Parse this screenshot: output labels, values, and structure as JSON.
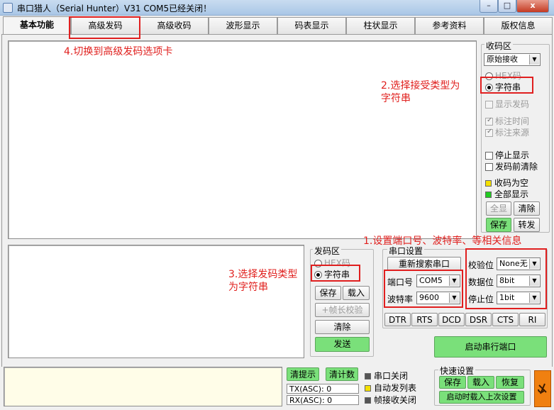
{
  "window": {
    "title": "串口猎人（Serial Hunter）V31    COM5已经关闭！",
    "minimize": "–",
    "maximize": "□",
    "close": "x"
  },
  "tabs": [
    "基本功能",
    "高级发码",
    "高级收码",
    "波形显示",
    "码表显示",
    "柱状显示",
    "参考资料",
    "版权信息"
  ],
  "receive_panel": {
    "title": "收码区",
    "mode": "原始接收",
    "radio_hex": "HEX码",
    "radio_str": "字符串",
    "show_send": "显示发码",
    "mark_time": "标注时间",
    "mark_source": "标注来源",
    "stop_display": "停止显示",
    "clear_before_send": "发码前清除",
    "empty_indicator": "收码为空",
    "full_display": "全部显示",
    "btn_fullscreen": "全显",
    "btn_clear": "清除",
    "btn_save": "保存",
    "btn_forward": "转发"
  },
  "send_panel": {
    "title": "发码区",
    "radio_hex": "HEX码",
    "radio_str": "字符串",
    "btn_save": "保存",
    "btn_load": "载入",
    "btn_frame_check": "+帧长校验",
    "btn_clear": "清除",
    "btn_send": "发送"
  },
  "serial_settings": {
    "title": "串口设置",
    "btn_rescan": "重新搜索串口",
    "port_label": "端口号",
    "port_value": "COM5",
    "baud_label": "波特率",
    "baud_value": "9600",
    "parity_label": "校验位",
    "parity_value": "None无",
    "databits_label": "数据位",
    "databits_value": "8bit",
    "stopbits_label": "停止位",
    "stopbits_value": "1bit",
    "signals": [
      "DTR",
      "RTS",
      "DCD",
      "DSR",
      "CTS",
      "RI"
    ],
    "btn_start": "启动串行端口"
  },
  "status": {
    "btn_clear_hint": "清提示",
    "btn_clear_count": "清计数",
    "tx_label": "TX(ASC):",
    "tx_value": "0",
    "rx_label": "RX(ASC):",
    "rx_value": "0",
    "port_closed": "串口关闭",
    "auto_send": "自动发列表",
    "frame_recv_close": "帧接收关闭",
    "quick_title": "快速设置",
    "btn_save": "保存",
    "btn_load": "载入",
    "btn_restore": "恢复",
    "btn_autoload": "启动时载入上次设置"
  },
  "annotations": {
    "a1": "1.设置端口号、波特率、等相关信息",
    "a2": "2.选择接受类型为\n字符串",
    "a3": "3.选择发码类型\n为字符串",
    "a4": "4.切换到高级发码选项卡"
  },
  "colors": {
    "highlight_red": "#e01f1f",
    "button_green": "#7ae07a",
    "led_yellow": "#f4e000",
    "led_green": "#22cc22"
  }
}
